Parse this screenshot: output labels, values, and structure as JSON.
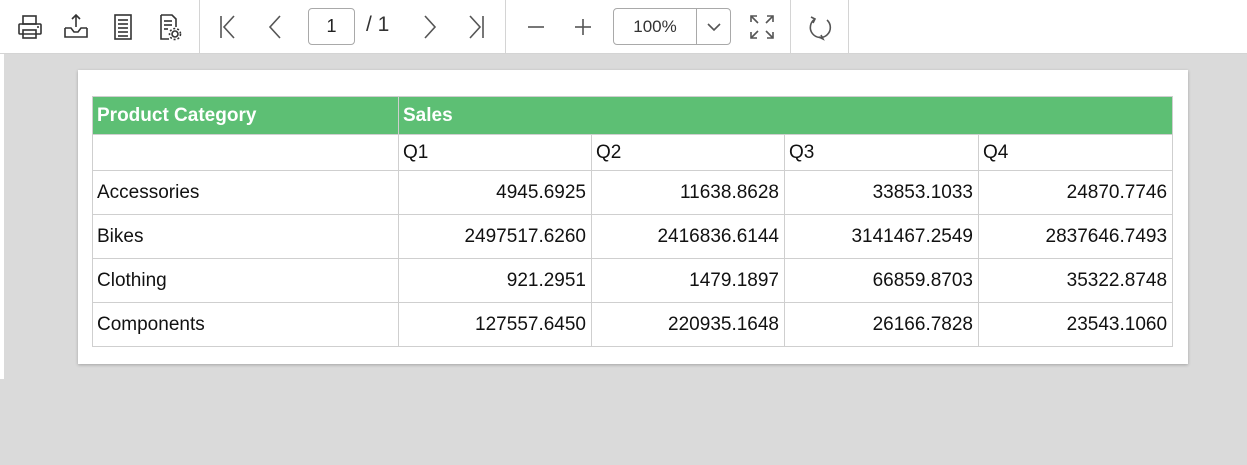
{
  "toolbar": {
    "buttons": [
      {
        "name": "print",
        "icon": "printer-icon"
      },
      {
        "name": "export",
        "icon": "export-icon"
      },
      {
        "name": "page-setup",
        "icon": "page-icon"
      },
      {
        "name": "page-settings",
        "icon": "page-settings-icon"
      },
      {
        "name": "first-page",
        "icon": "first-page-icon"
      },
      {
        "name": "previous-page",
        "icon": "chevron-left-icon"
      },
      {
        "name": "next-page",
        "icon": "chevron-right-icon"
      },
      {
        "name": "last-page",
        "icon": "last-page-icon"
      },
      {
        "name": "zoom-out",
        "icon": "minus-icon"
      },
      {
        "name": "zoom-in",
        "icon": "plus-icon"
      },
      {
        "name": "fit-page",
        "icon": "fit-to-page-icon"
      },
      {
        "name": "refresh",
        "icon": "refresh-icon"
      }
    ],
    "current_page": "1",
    "page_total": "/ 1",
    "zoom": "100%"
  },
  "report": {
    "header_category": "Product Category",
    "header_sales": "Sales",
    "quarters": [
      "Q1",
      "Q2",
      "Q3",
      "Q4"
    ],
    "rows": [
      {
        "category": "Accessories",
        "values": [
          "4945.6925",
          "11638.8628",
          "33853.1033",
          "24870.7746"
        ]
      },
      {
        "category": "Bikes",
        "values": [
          "2497517.6260",
          "2416836.6144",
          "3141467.2549",
          "2837646.7493"
        ]
      },
      {
        "category": "Clothing",
        "values": [
          "921.2951",
          "1479.1897",
          "66859.8703",
          "35322.8748"
        ]
      },
      {
        "category": "Components",
        "values": [
          "127557.6450",
          "220935.1648",
          "26166.7828",
          "23543.1060"
        ]
      }
    ]
  },
  "colors": {
    "header_background": "#5dbf74",
    "header_text": "#ffffff",
    "viewer_background": "#dadada"
  }
}
